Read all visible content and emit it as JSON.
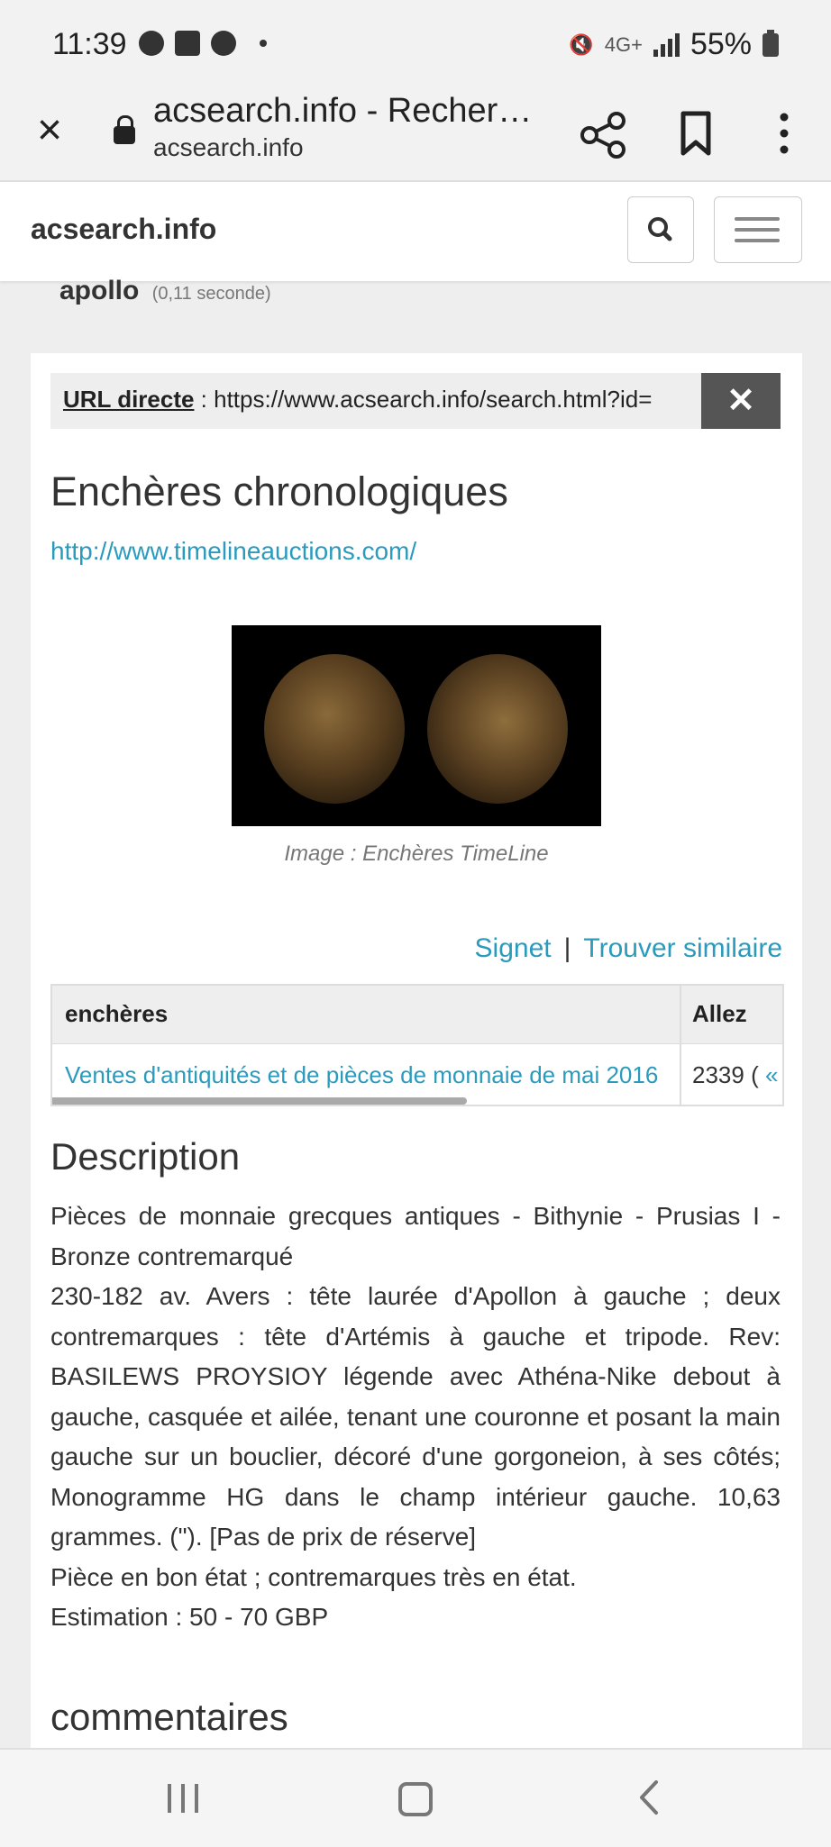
{
  "status_bar": {
    "time": "11:39",
    "network": "4G+",
    "battery": "55%"
  },
  "browser": {
    "tab_title": "acsearch.info - Recher…",
    "domain": "acsearch.info",
    "icons": [
      "close-icon",
      "lock-icon",
      "share-icon",
      "bookmark-icon",
      "more-vertical-icon"
    ]
  },
  "site": {
    "brand": "acsearch.info",
    "icons": [
      "search-icon",
      "hamburger-menu-icon"
    ]
  },
  "query": {
    "term": "apollo",
    "time": "(0,11 seconde)"
  },
  "card": {
    "url_label": "URL directe",
    "url_value": " : https://www.acsearch.info/search.html?id=",
    "url_close": "✕",
    "auction_title": "Enchères chronologiques",
    "auction_link": "http://www.timelineauctions.com/",
    "image_caption": "Image : Enchères TimeLine",
    "actions": {
      "bookmark": "Signet",
      "separator": "|",
      "similar": "Trouver similaire"
    },
    "table": {
      "headers": [
        "enchères",
        "Allez"
      ],
      "row": {
        "sale": "Ventes d'antiquités et de pièces de monnaie de mai 2016",
        "lot": "2339 (",
        "lot_link": "«"
      }
    },
    "description_title": "Description",
    "description": [
      "Pièces de monnaie grecques antiques - Bithynie - Prusias I - Bronze contremarqué",
      "230-182 av. Avers : tête laurée d'Apollon à gauche ; deux contremarques : tête d'Artémis à gauche et tripode. Rev: BASILEWS PROYSIOY légende avec Athéna-Nike debout à gauche, casquée et ailée, tenant une couronne et posant la main gauche sur un bouclier, décoré d'une gorgoneion, à ses côtés; Monogramme HG dans le champ intérieur gauche. 10,63 grammes. (\"). [Pas de prix de réserve]",
      "Pièce en bon état ; contremarques très en état.",
      "Estimation : 50 - 70 GBP"
    ],
    "comments_title": "commentaires"
  },
  "nav": {
    "icons": [
      "recents-icon",
      "home-icon",
      "back-icon"
    ]
  },
  "colors": {
    "link": "#2a9bbd",
    "close_button": "#555555"
  }
}
